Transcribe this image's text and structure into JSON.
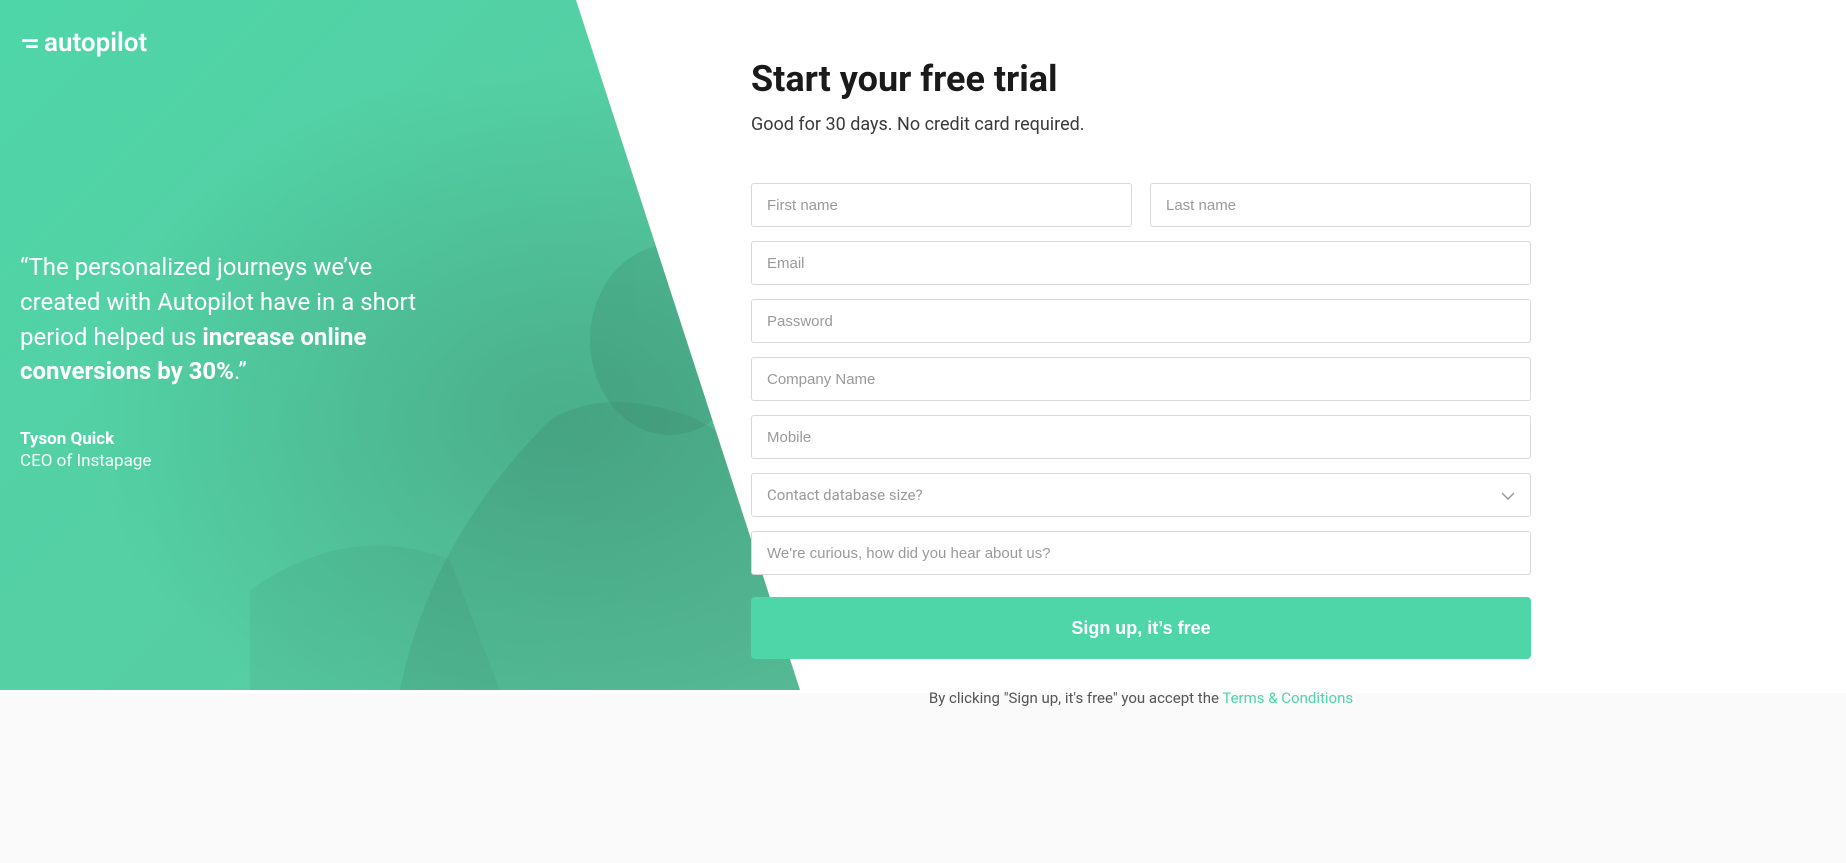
{
  "brand": {
    "name": "autopilot"
  },
  "testimonial": {
    "quote_prefix": "“The personalized journeys we’ve created with Autopilot have in a short period helped us ",
    "quote_bold": "increase online conversions by 30%",
    "quote_suffix": ".”",
    "author": "Tyson Quick",
    "role": "CEO of Instapage"
  },
  "form": {
    "title": "Start your free trial",
    "subtitle": "Good for 30 days. No credit card required.",
    "fields": {
      "first_name_placeholder": "First name",
      "last_name_placeholder": "Last name",
      "email_placeholder": "Email",
      "password_placeholder": "Password",
      "company_placeholder": "Company Name",
      "mobile_placeholder": "Mobile",
      "database_size_placeholder": "Contact database size?",
      "hear_about_placeholder": "We're curious, how did you hear about us?"
    },
    "submit_label": "Sign up, it’s free",
    "terms_prefix": "By clicking \"Sign up, it's free\" you accept the ",
    "terms_link_label": "Terms & Conditions"
  }
}
